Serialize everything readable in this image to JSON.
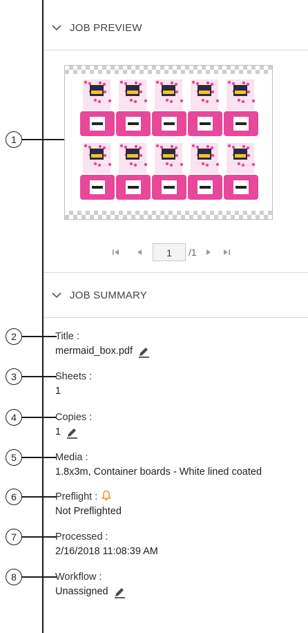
{
  "preview": {
    "header": "JOB PREVIEW"
  },
  "pager": {
    "current_page": "1",
    "total": "/1"
  },
  "summary": {
    "header": "JOB SUMMARY",
    "title_label": "Title :",
    "title_value": "mermaid_box.pdf",
    "sheets_label": "Sheets :",
    "sheets_value": "1",
    "copies_label": "Copies :",
    "copies_value": "1",
    "media_label": "Media :",
    "media_value": "1.8x3m, Container boards - White lined coated",
    "preflight_label": "Preflight :",
    "preflight_value": "Not Preflighted",
    "processed_label": "Processed :",
    "processed_value": "2/16/2018 11:08:39 AM",
    "workflow_label": "Workflow :",
    "workflow_value": "Unassigned"
  },
  "callouts": [
    "1",
    "2",
    "3",
    "4",
    "5",
    "6",
    "7",
    "8"
  ],
  "colors": {
    "accent_pink": "#e8479a",
    "bell_orange": "#e69a1f",
    "divider": "#d9d9d9"
  },
  "icons": [
    "chevron-down-icon",
    "first-page-icon",
    "prev-page-icon",
    "next-page-icon",
    "last-page-icon",
    "pencil-icon",
    "bell-icon"
  ]
}
